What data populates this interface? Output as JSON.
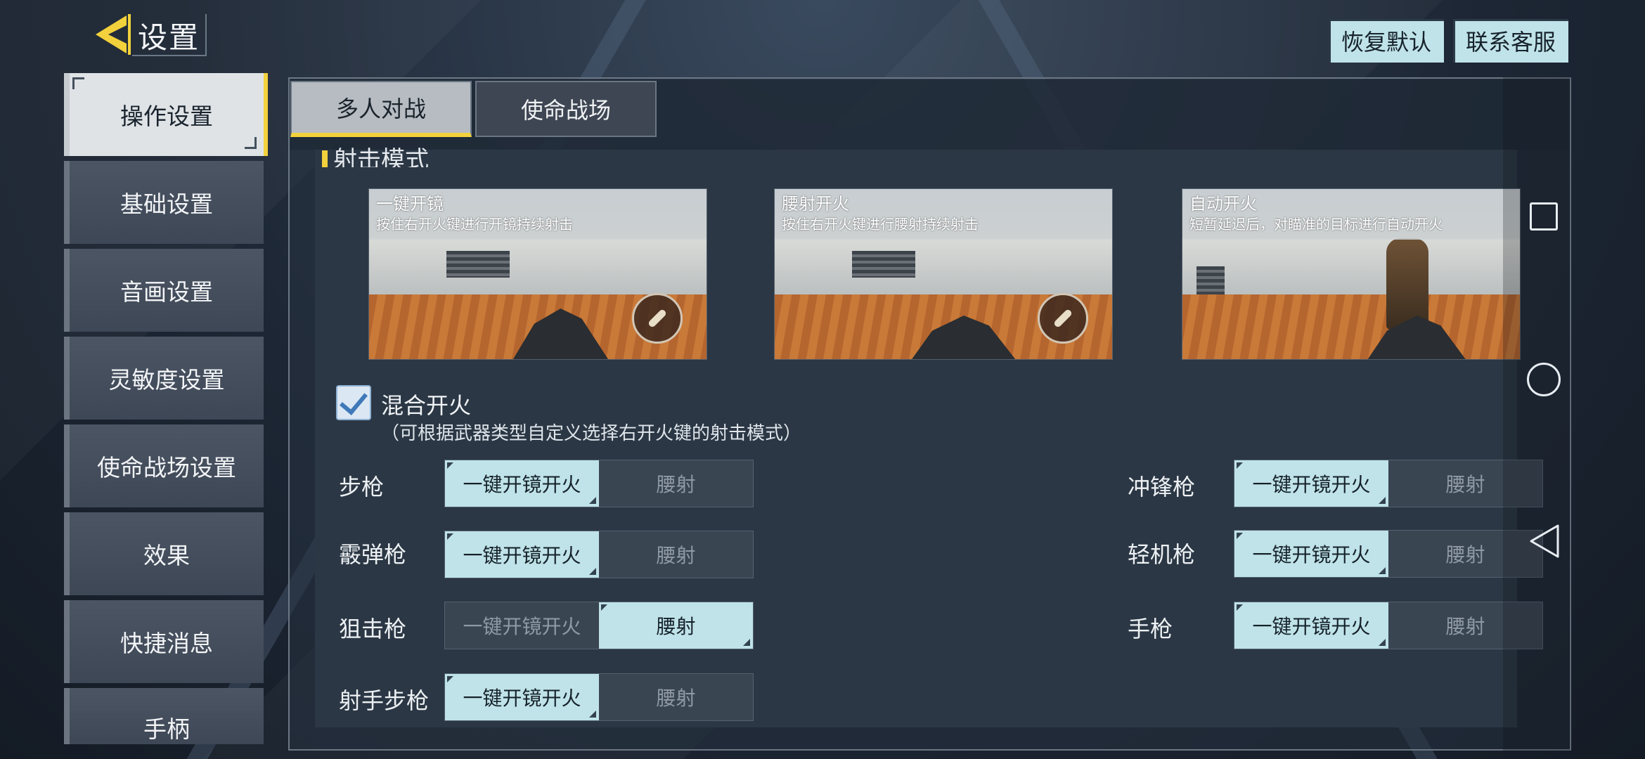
{
  "header": {
    "title": "设置",
    "restore_default": "恢复默认",
    "contact_support": "联系客服"
  },
  "sidebar": {
    "items": [
      {
        "label": "操作设置",
        "active": true
      },
      {
        "label": "基础设置"
      },
      {
        "label": "音画设置"
      },
      {
        "label": "灵敏度设置"
      },
      {
        "label": "使命战场设置"
      },
      {
        "label": "效果"
      },
      {
        "label": "快捷消息"
      },
      {
        "label": "手柄"
      }
    ]
  },
  "tabs": [
    {
      "label": "多人对战",
      "active": true
    },
    {
      "label": "使命战场"
    }
  ],
  "section": {
    "title": "射击模式"
  },
  "modes": [
    {
      "title": "一键开镜",
      "desc": "按住右开火键进行开镜持续射击"
    },
    {
      "title": "腰射开火",
      "desc": "按住右开火键进行腰射持续射击"
    },
    {
      "title": "自动开火",
      "desc": "短暂延迟后，对瞄准的目标进行自动开火"
    }
  ],
  "mixed_fire": {
    "label": "混合开火",
    "desc": "（可根据武器类型自定义选择右开火键的射击模式）",
    "checked": true
  },
  "options": {
    "ads": "一键开镜开火",
    "hip": "腰射"
  },
  "weapons": [
    {
      "name": "步枪",
      "selected": "ads"
    },
    {
      "name": "霰弹枪",
      "selected": "ads"
    },
    {
      "name": "狙击枪",
      "selected": "hip"
    },
    {
      "name": "射手步枪",
      "selected": "ads"
    },
    {
      "name": "冲锋枪",
      "selected": "ads"
    },
    {
      "name": "轻机枪",
      "selected": "ads"
    },
    {
      "name": "手枪",
      "selected": "ads"
    }
  ],
  "colors": {
    "accent": "#f2d13c",
    "selected_option": "#bfe3e8"
  },
  "icons": {
    "back": "back-arrow-icon",
    "nav_recent": "square-icon",
    "nav_home": "circle-icon",
    "nav_back": "triangle-back-icon"
  }
}
